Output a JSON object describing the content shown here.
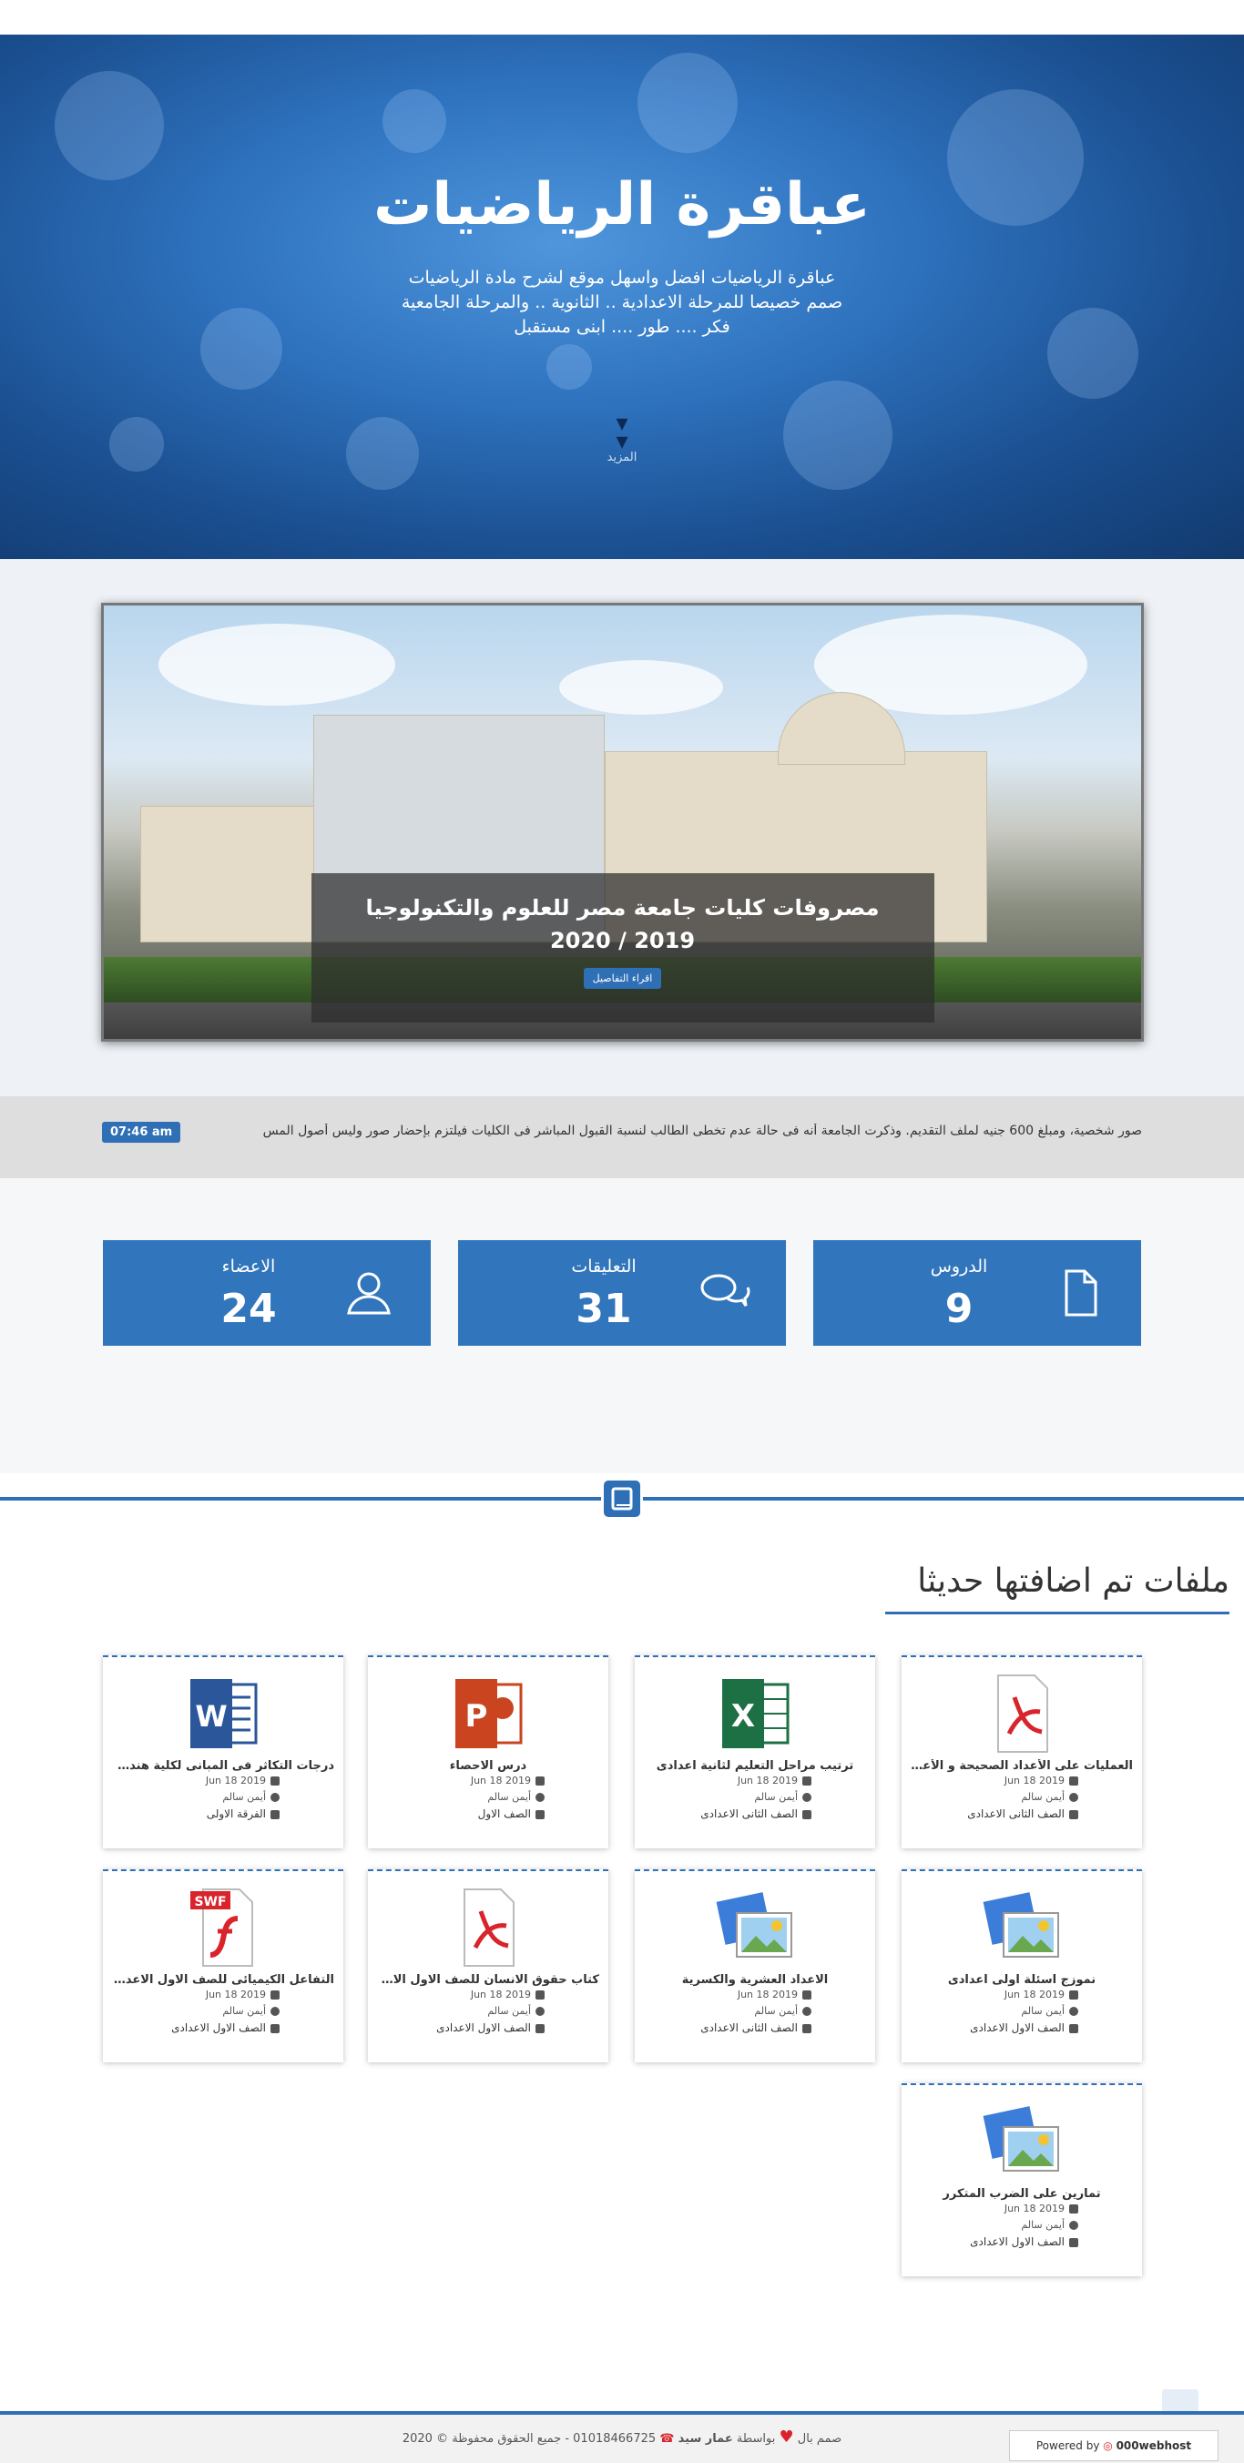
{
  "hero": {
    "title": "عباقرة الرياضيات",
    "tagline1": "عباقرة الرياضيات افضل واسهل موقع لشرح مادة الرياضيات",
    "tagline2": "صمم خصيصا للمرحلة الاعدادية .. الثانوية .. والمرحلة الجامعية",
    "tagline3": "فكر .... طور .... ابنى مستقبل",
    "more_label": "المزيد"
  },
  "slider": {
    "caption_title": "مصروفات كليات جامعة مصر للعلوم والتكنولوجيا 2019 / 2020",
    "details_button": "اقراء التفاصيل"
  },
  "ticker": {
    "text": "صور شخصية، ومبلغ 600 جنيه لملف التقديم. وذكرت الجامعة أنه فى حالة عدم تخطى الطالب لنسبة القبول المباشر فى الكليات فيلتزم بإحضار صور وليس أصول المس",
    "clock": "07:46 am"
  },
  "stats": [
    {
      "label": "الدروس",
      "value": "9",
      "icon": "file-icon"
    },
    {
      "label": "التعليقات",
      "value": "31",
      "icon": "comments-icon"
    },
    {
      "label": "الاعضاء",
      "value": "24",
      "icon": "user-icon"
    }
  ],
  "recent": {
    "title": "ملفات تم اضافتها حديثا",
    "files": [
      {
        "title": "العمليات على الأعداد الصحيحة و الأعد...",
        "date": "Jun 18 2019",
        "author": "أيمن سالم",
        "grade": "الصف الثانى الاعدادى",
        "type": "pdf-icon"
      },
      {
        "title": "ترتيب مراحل التعليم لثانية اعدادى",
        "date": "Jun 18 2019",
        "author": "أيمن سالم",
        "grade": "الصف الثانى الاعدادى",
        "type": "excel-icon"
      },
      {
        "title": "درس الاحصاء",
        "date": "Jun 18 2019",
        "author": "أيمن سالم",
        "grade": "الصف الاول",
        "type": "powerpoint-icon"
      },
      {
        "title": "درجات التكاثر فى المبانى لكلية هندسة",
        "date": "Jun 18 2019",
        "author": "أيمن سالم",
        "grade": "الفرقة الاولى",
        "type": "word-icon"
      },
      {
        "title": "نموزج اسئلة اولى اعدادى",
        "date": "Jun 18 2019",
        "author": "أيمن سالم",
        "grade": "الصف الاول الاعدادى",
        "type": "image-icon"
      },
      {
        "title": "الاعداد العشرية والكسرية",
        "date": "Jun 18 2019",
        "author": "أيمن سالم",
        "grade": "الصف الثانى الاعدادى",
        "type": "image-icon"
      },
      {
        "title": "كتاب حقوق الانسان للصف الاول الاعد...",
        "date": "Jun 18 2019",
        "author": "أيمن سالم",
        "grade": "الصف الاول الاعدادى",
        "type": "pdf-icon"
      },
      {
        "title": "التفاعل الكيميائى للصف الاول الاعدادى",
        "date": "Jun 18 2019",
        "author": "أيمن سالم",
        "grade": "الصف الاول الاعدادى",
        "type": "swf-icon"
      },
      {
        "title": "تمارين على الضرب المتكرر",
        "date": "Jun 18 2019",
        "author": "أيمن سالم",
        "grade": "الصف الاول الاعدادى",
        "type": "image-icon"
      }
    ]
  },
  "footer": {
    "designed_by": "صمم بال",
    "by_word": "بواسطة",
    "author": "عمار سيد",
    "phone": "01018466725",
    "rights": "- جميع الحقوق محفوظة © 2020",
    "powered": "Powered by",
    "host": "000webhost"
  },
  "colors": {
    "accent": "#2e6fb5",
    "stat_bg": "#3176bc",
    "heart": "#d9242b"
  }
}
